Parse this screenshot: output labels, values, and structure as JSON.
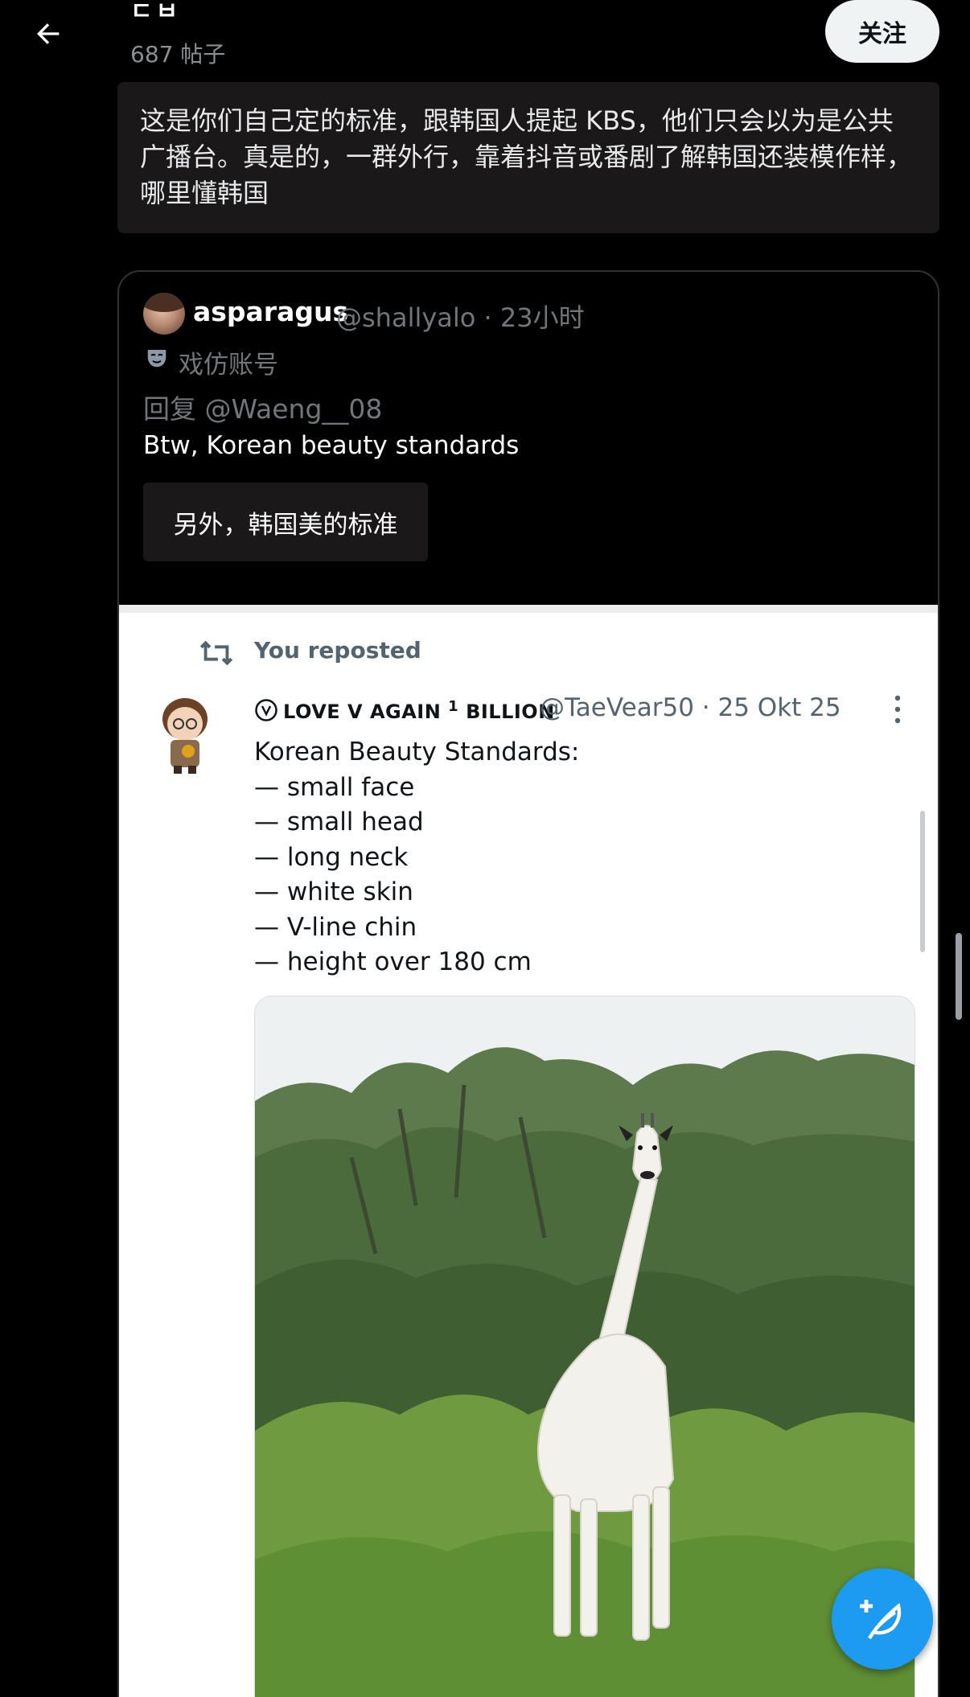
{
  "header": {
    "profile_name": "ㄷㅂ",
    "post_count": "687 帖子",
    "follow_label": "关注"
  },
  "translation": {
    "text": "这是你们自己定的标准，跟韩国人提起 KBS，他们只会以为是公共广播台。真是的，一群外行，靠着抖音或番剧了解韩国还装模作样，哪里懂韩国"
  },
  "quoted_post": {
    "name": "asparagus",
    "handle_time": "@shallyalo · 23小时",
    "parody_label": "戏仿账号",
    "reply_to": "回复 @Waeng__08",
    "body": "Btw, Korean beauty standards",
    "translation": "另外，韩国美的标准"
  },
  "embedded_tweet": {
    "repost_label": "You reposted",
    "name": "LOVE V AGAIN",
    "name_sup": "1",
    "name_suffix": "BILLION",
    "handle_time": "@TaeVear50 · 25 Okt 25",
    "text": "Korean Beauty Standards:\n— small face\n— small head\n— long neck\n— white skin\n— V-line chin\n— height over 180 cm"
  },
  "icons": {
    "back": "arrow-left-icon",
    "parody": "theater-mask-icon",
    "repost": "repost-icon",
    "more": "more-vertical-icon",
    "compose": "compose-feather-icon"
  },
  "colors": {
    "background": "#000000",
    "accent": "#1d9bf0",
    "muted_text": "#71767b",
    "translation_box": "#1b1819"
  }
}
